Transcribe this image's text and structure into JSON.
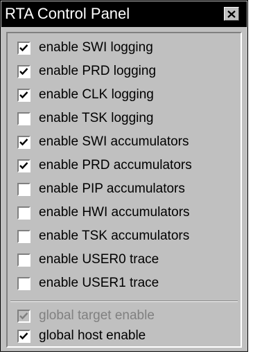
{
  "window": {
    "title": "RTA Control Panel",
    "close_icon": "close-icon"
  },
  "options": [
    {
      "label": "enable SWI logging",
      "checked": true
    },
    {
      "label": "enable PRD logging",
      "checked": true
    },
    {
      "label": "enable CLK logging",
      "checked": true
    },
    {
      "label": "enable TSK logging",
      "checked": false
    },
    {
      "label": "enable SWI accumulators",
      "checked": true
    },
    {
      "label": "enable PRD accumulators",
      "checked": true
    },
    {
      "label": "enable PIP accumulators",
      "checked": false
    },
    {
      "label": "enable HWI accumulators",
      "checked": false
    },
    {
      "label": "enable TSK accumulators",
      "checked": false
    },
    {
      "label": "enable USER0 trace",
      "checked": false
    },
    {
      "label": "enable USER1 trace",
      "checked": false
    }
  ],
  "global": [
    {
      "label": "global target enable",
      "checked": true,
      "disabled": true
    },
    {
      "label": "global host enable",
      "checked": true,
      "disabled": false
    }
  ],
  "colors": {
    "window_bg": "#c0c0c0",
    "titlebar_bg": "#000000",
    "titlebar_text": "#ffffff",
    "disabled_text": "#808080"
  }
}
